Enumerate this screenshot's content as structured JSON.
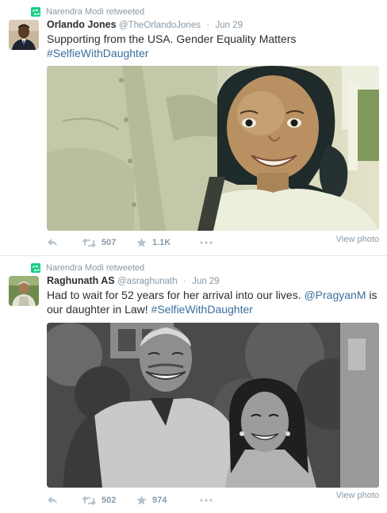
{
  "tweets": [
    {
      "retweeted_by": "Narendra Modi retweeted",
      "name": "Orlando Jones",
      "handle": "@TheOrlandoJones",
      "time": "Jun 29",
      "text": "Supporting from the USA. Gender Equality Matters",
      "hashtag": "#SelfieWithDaughter",
      "retweets": "507",
      "likes": "1.1K",
      "view_photo": "View photo"
    },
    {
      "retweeted_by": "Narendra Modi retweeted",
      "name": "Raghunath AS",
      "handle": "@asraghunath",
      "time": "Jun 29",
      "text_part1": "Had to wait for 52 years for her arrival into our lives.",
      "mention": "@PragyanM",
      "text_part2": "is our daughter in Law!",
      "hashtag": "#SelfieWithDaughter",
      "retweets": "502",
      "likes": "974",
      "view_photo": "View photo"
    }
  ],
  "colors": {
    "retweet_green": "#19cf86",
    "link_blue": "#3b6e9c",
    "meta_gray": "#8899a6"
  },
  "icons": [
    "retweet-icon",
    "reply-icon",
    "favorite-icon",
    "more-icon"
  ]
}
